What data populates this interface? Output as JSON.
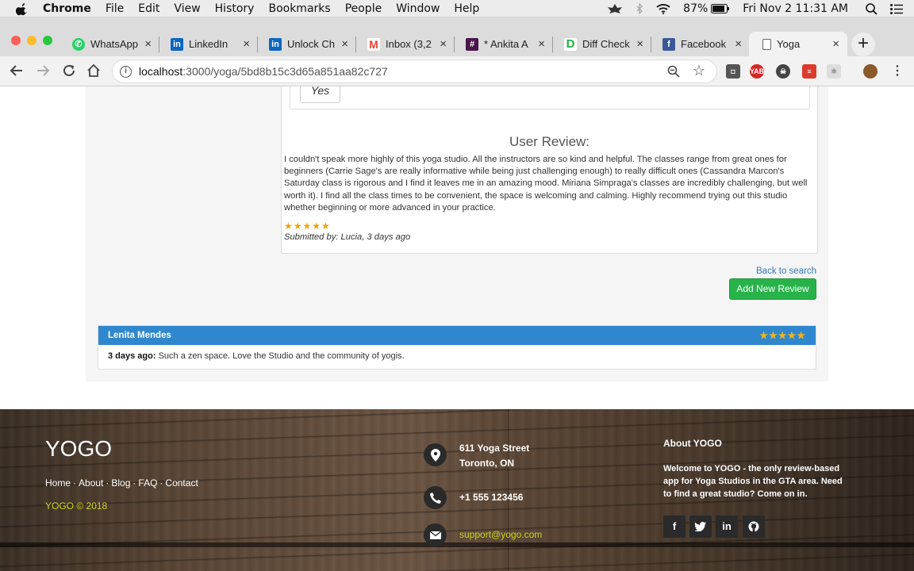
{
  "menubar": {
    "app": "Chrome",
    "menus": [
      "File",
      "Edit",
      "View",
      "History",
      "Bookmarks",
      "People",
      "Window",
      "Help"
    ],
    "battery": "87%",
    "clock": "Fri Nov 2  11:31 AM"
  },
  "tabs": [
    {
      "title": "WhatsApp",
      "icon": "whatsapp-icon",
      "color": "#25d366"
    },
    {
      "title": "LinkedIn",
      "icon": "linkedin-icon",
      "color": "#0a66c2"
    },
    {
      "title": "Unlock Ch",
      "icon": "linkedin-icon",
      "color": "#0a66c2"
    },
    {
      "title": "Inbox (3,2",
      "icon": "gmail-icon",
      "color": "#ea4335"
    },
    {
      "title": "* Ankita A",
      "icon": "slack-icon",
      "color": "#4a154b"
    },
    {
      "title": "Diff Check",
      "icon": "diffchecker-icon",
      "color": "#1fb141"
    },
    {
      "title": "Facebook",
      "icon": "facebook-icon",
      "color": "#3b5998"
    },
    {
      "title": "Yoga",
      "icon": "page-icon",
      "color": "#666666"
    }
  ],
  "toolbar": {
    "url_host": "localhost",
    "url_path": ":3000/yoga/5bd8b15c3d65a851aa82c727"
  },
  "page": {
    "yes_label": "Yes",
    "review_heading": "User Review:",
    "review_text": "I couldn't speak more highly of this yoga studio. All the instructors are so kind and helpful. The classes range from great ones for beginners (Carrie Sage's are really informative while being just challenging enough) to really difficult ones (Cassandra Marcon's Saturday class is rigorous and I find it leaves me in an amazing mood. Miriana Simpraga's classes are incredibly challenging, but well worth it). I find all the class times to be convenient, the space is welcoming and calming. Highly recommend trying out this studio whether beginning or more advanced in your practice.",
    "review_stars": "★★★★★",
    "review_rating": 5,
    "submitted_by": "Submitted by: Lucia, 3 days ago",
    "back_link": "Back to search",
    "add_review": "Add New Review",
    "comment": {
      "author": "Lenita Mendes",
      "stars": "★★★★★",
      "rating": 5,
      "when": "3 days ago:",
      "text": " Such a zen space. Love the Studio and the community of yogis."
    }
  },
  "footer": {
    "logo": "YOGO",
    "links": [
      "Home",
      "About",
      "Blog",
      "FAQ",
      "Contact"
    ],
    "copyright": "YOGO © 2018",
    "address_line1": "611 Yoga Street",
    "address_line2": "Toronto, ON",
    "phone": "+1 555 123456",
    "email": "support@yogo.com",
    "about_heading": "About YOGO",
    "about_text": "Welcome to YOGO - the only review-based app for Yoga Studios in the GTA area. Need to find a great studio? Come on in.",
    "social": [
      "f",
      "t",
      "in",
      "gh"
    ]
  }
}
